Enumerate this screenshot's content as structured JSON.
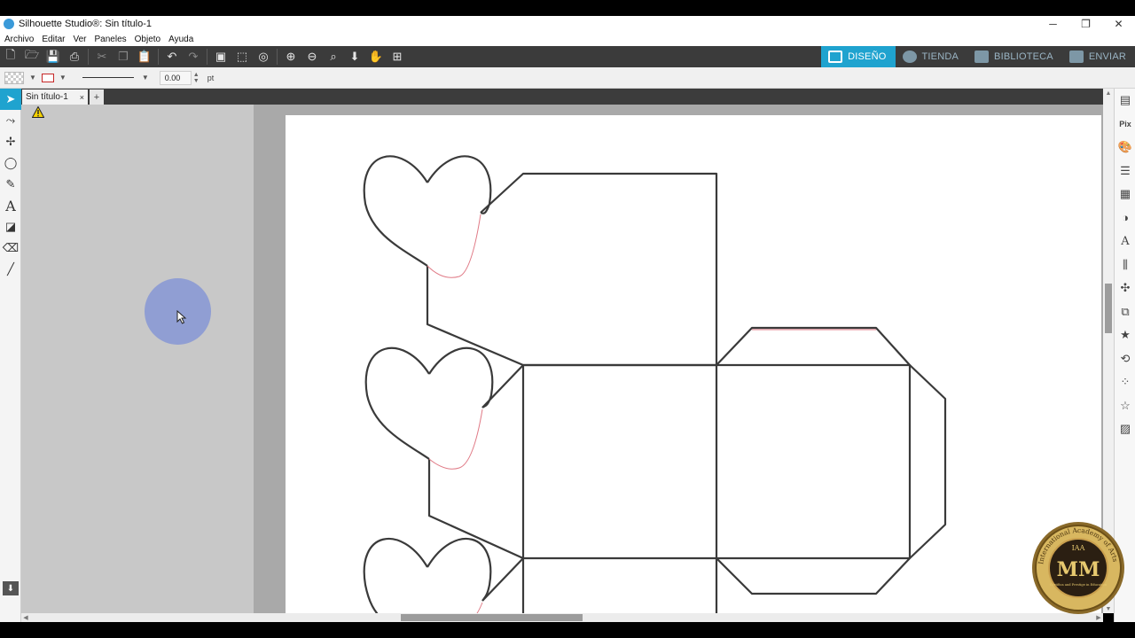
{
  "window": {
    "title": "Silhouette Studio®: Sin título-1",
    "controls": {
      "minimize": "─",
      "restore": "❐",
      "close": "✕"
    }
  },
  "menu": [
    "Archivo",
    "Editar",
    "Ver",
    "Paneles",
    "Objeto",
    "Ayuda"
  ],
  "toolbar": {
    "nav_tabs": [
      {
        "label": "DISEÑO",
        "active": true
      },
      {
        "label": "TIENDA",
        "active": false
      },
      {
        "label": "BIBLIOTECA",
        "active": false
      },
      {
        "label": "ENVIAR",
        "active": false
      }
    ]
  },
  "properties": {
    "line_width_value": "0.00",
    "line_width_unit": "pt",
    "line_color": "#c62828"
  },
  "document": {
    "tab_label": "Sin título-1",
    "close_glyph": "×",
    "add_glyph": "+"
  },
  "colors": {
    "accent": "#1fa3cf",
    "toolbar_bg": "#3b3b3b",
    "cut_line": "#3a3a3a",
    "pink_line": "#e07a86"
  },
  "badge": {
    "arc_text": "International Academy of Arts",
    "top_text": "IAA",
    "monogram": "MM",
    "bottom_text": "Certifica and Prestige in Education"
  }
}
